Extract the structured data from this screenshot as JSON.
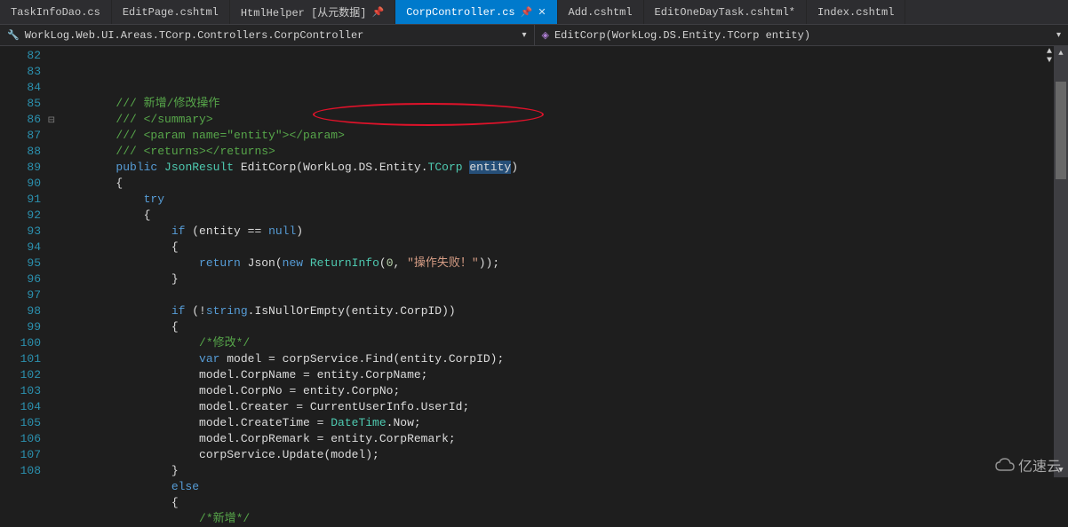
{
  "tabs": [
    {
      "label": "TaskInfoDao.cs",
      "active": false,
      "pinned": false,
      "closable": false
    },
    {
      "label": "EditPage.cshtml",
      "active": false,
      "pinned": false,
      "closable": false
    },
    {
      "label": "HtmlHelper [从元数据]",
      "active": false,
      "pinned": true,
      "closable": false
    },
    {
      "label": "CorpController.cs",
      "active": true,
      "pinned": true,
      "closable": true
    },
    {
      "label": "Add.cshtml",
      "active": false,
      "pinned": false,
      "closable": false
    },
    {
      "label": "EditOneDayTask.cshtml*",
      "active": false,
      "pinned": false,
      "closable": false
    },
    {
      "label": "Index.cshtml",
      "active": false,
      "pinned": false,
      "closable": false
    }
  ],
  "nav": {
    "left": "WorkLog.Web.UI.Areas.TCorp.Controllers.CorpController",
    "right": "EditCorp(WorkLog.DS.Entity.TCorp entity)"
  },
  "line_start": 82,
  "line_end": 108,
  "fold_at": 86,
  "code_lines": [
    [
      [
        "        ",
        "p"
      ],
      [
        "/// 新增/修改操作",
        "comment"
      ]
    ],
    [
      [
        "        ",
        "p"
      ],
      [
        "/// </summary>",
        "comment"
      ]
    ],
    [
      [
        "        ",
        "p"
      ],
      [
        "/// <param name=\"entity\"></param>",
        "comment"
      ]
    ],
    [
      [
        "        ",
        "p"
      ],
      [
        "/// <returns></returns>",
        "comment"
      ]
    ],
    [
      [
        "        ",
        "p"
      ],
      [
        "public",
        "keyword"
      ],
      [
        " ",
        "p"
      ],
      [
        "JsonResult",
        "type"
      ],
      [
        " EditCorp(",
        "default"
      ],
      [
        "WorkLog",
        "default"
      ],
      [
        ".",
        "p"
      ],
      [
        "DS",
        "default"
      ],
      [
        ".",
        "p"
      ],
      [
        "Entity",
        "default"
      ],
      [
        ".",
        "p"
      ],
      [
        "TCorp",
        "type"
      ],
      [
        " ",
        "p"
      ],
      [
        "entity",
        "default",
        "sel"
      ],
      [
        ")",
        "default"
      ]
    ],
    [
      [
        "        {",
        "p"
      ]
    ],
    [
      [
        "            ",
        "p"
      ],
      [
        "try",
        "keyword"
      ]
    ],
    [
      [
        "            {",
        "p"
      ]
    ],
    [
      [
        "                ",
        "p"
      ],
      [
        "if",
        "keyword"
      ],
      [
        " (entity == ",
        "default"
      ],
      [
        "null",
        "keyword"
      ],
      [
        ")",
        "default"
      ]
    ],
    [
      [
        "                {",
        "p"
      ]
    ],
    [
      [
        "                    ",
        "p"
      ],
      [
        "return",
        "keyword"
      ],
      [
        " Json(",
        "default"
      ],
      [
        "new",
        "keyword"
      ],
      [
        " ",
        "p"
      ],
      [
        "ReturnInfo",
        "type"
      ],
      [
        "(",
        "p"
      ],
      [
        "0",
        "number"
      ],
      [
        ", ",
        "p"
      ],
      [
        "\"操作失败！\"",
        "string"
      ],
      [
        "));",
        "p"
      ]
    ],
    [
      [
        "                }",
        "p"
      ]
    ],
    [
      [
        "",
        "p"
      ]
    ],
    [
      [
        "                ",
        "p"
      ],
      [
        "if",
        "keyword"
      ],
      [
        " (!",
        "default"
      ],
      [
        "string",
        "keyword"
      ],
      [
        ".IsNullOrEmpty(entity.CorpID))",
        "default"
      ]
    ],
    [
      [
        "                {",
        "p"
      ]
    ],
    [
      [
        "                    ",
        "p"
      ],
      [
        "/*修改*/",
        "comment"
      ]
    ],
    [
      [
        "                    ",
        "p"
      ],
      [
        "var",
        "keyword"
      ],
      [
        " model = corpService.Find(entity.CorpID);",
        "default"
      ]
    ],
    [
      [
        "                    model.CorpName = entity.CorpName;",
        "default"
      ]
    ],
    [
      [
        "                    model.CorpNo = entity.CorpNo;",
        "default"
      ]
    ],
    [
      [
        "                    model.Creater = CurrentUserInfo.UserId;",
        "default"
      ]
    ],
    [
      [
        "                    model.CreateTime = ",
        "default"
      ],
      [
        "DateTime",
        "type"
      ],
      [
        ".Now;",
        "default"
      ]
    ],
    [
      [
        "                    model.CorpRemark = entity.CorpRemark;",
        "default"
      ]
    ],
    [
      [
        "                    corpService.Update(model);",
        "default"
      ]
    ],
    [
      [
        "                }",
        "p"
      ]
    ],
    [
      [
        "                ",
        "p"
      ],
      [
        "else",
        "keyword"
      ]
    ],
    [
      [
        "                {",
        "p"
      ]
    ],
    [
      [
        "                    ",
        "p"
      ],
      [
        "/*新增*/",
        "comment"
      ]
    ]
  ],
  "watermark": "亿速云"
}
